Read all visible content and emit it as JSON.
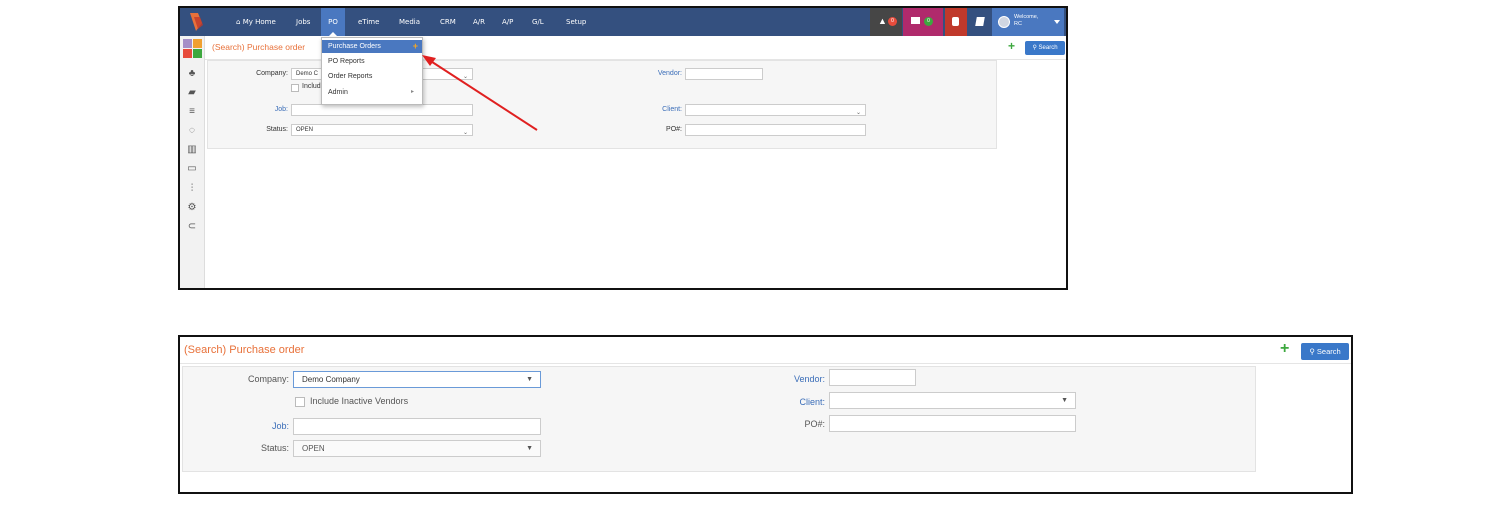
{
  "top": {
    "nav": {
      "home_icon": "home-icon",
      "items": [
        "My Home",
        "Jobs",
        "PO",
        "eTime",
        "Media",
        "CRM",
        "A/R",
        "A/P",
        "G/L",
        "Setup"
      ],
      "active": "PO",
      "notification_badge": "0",
      "mail_badge": "0",
      "welcome_line1": "Welcome,",
      "welcome_line2": "RC"
    },
    "dropdown": {
      "items": [
        "Purchase Orders",
        "PO Reports",
        "Order Reports",
        "Admin"
      ],
      "add_icon": "+",
      "submenu_icon": "▸"
    },
    "title": "(Search) Purchase order",
    "search_label": "Search",
    "add_label": "+",
    "form": {
      "company_label": "Company:",
      "company_value": "Demo C",
      "include_label": "Includ",
      "job_label": "Job:",
      "status_label": "Status:",
      "status_value": "OPEN",
      "vendor_label": "Vendor:",
      "client_label": "Client:",
      "po_label": "PO#:"
    }
  },
  "bottom": {
    "title": "(Search) Purchase order",
    "search_label": "Search",
    "add_label": "+",
    "form": {
      "company_label": "Company:",
      "company_value": "Demo Company",
      "include_label": "Include Inactive Vendors",
      "job_label": "Job:",
      "status_label": "Status:",
      "status_value": "OPEN",
      "vendor_label": "Vendor:",
      "client_label": "Client:",
      "po_label": "PO#:"
    }
  },
  "colors": {
    "nav_bg": "#34507f",
    "accent": "#4a78c0",
    "title_orange": "#e8713a",
    "add_green": "#3da83f",
    "arrow_red": "#e02020"
  }
}
